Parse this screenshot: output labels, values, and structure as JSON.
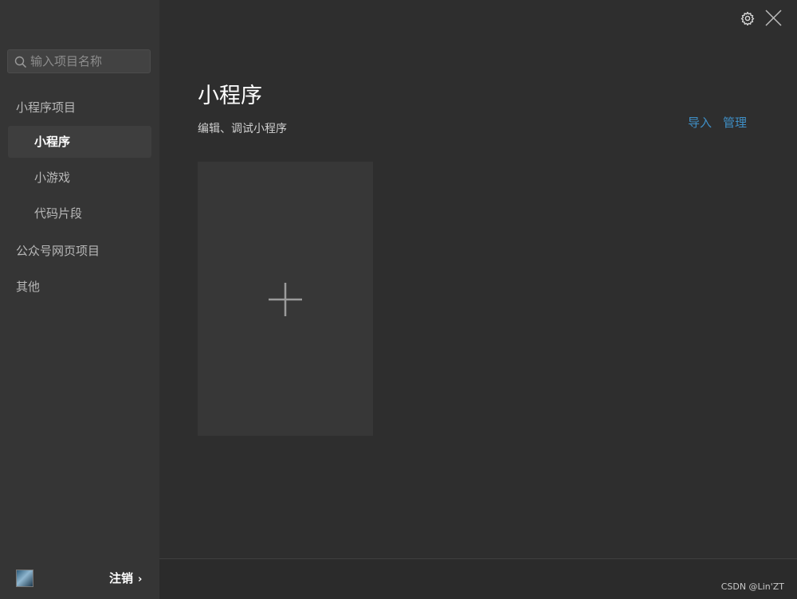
{
  "sidebar": {
    "search": {
      "placeholder": "输入项目名称",
      "value": ""
    },
    "groups": [
      {
        "label": "小程序项目"
      },
      {
        "label": "公众号网页项目"
      },
      {
        "label": "其他"
      }
    ],
    "items": [
      {
        "label": "小程序",
        "active": true
      },
      {
        "label": "小游戏",
        "active": false
      },
      {
        "label": "代码片段",
        "active": false
      }
    ],
    "logout_label": "注销",
    "logout_chevron": "›"
  },
  "header": {
    "icons": [
      "gear-icon",
      "close-icon"
    ]
  },
  "main": {
    "title": "小程序",
    "subtitle": "编辑、调试小程序",
    "links": {
      "import": "导入",
      "manage": "管理"
    },
    "new_card_icon": "plus-icon"
  },
  "watermark": "CSDN @Lin'ZT",
  "colors": {
    "sidebar_bg": "#353535",
    "main_bg": "#2e2e2e",
    "link": "#3f8fc6",
    "card_bg": "#373737"
  }
}
